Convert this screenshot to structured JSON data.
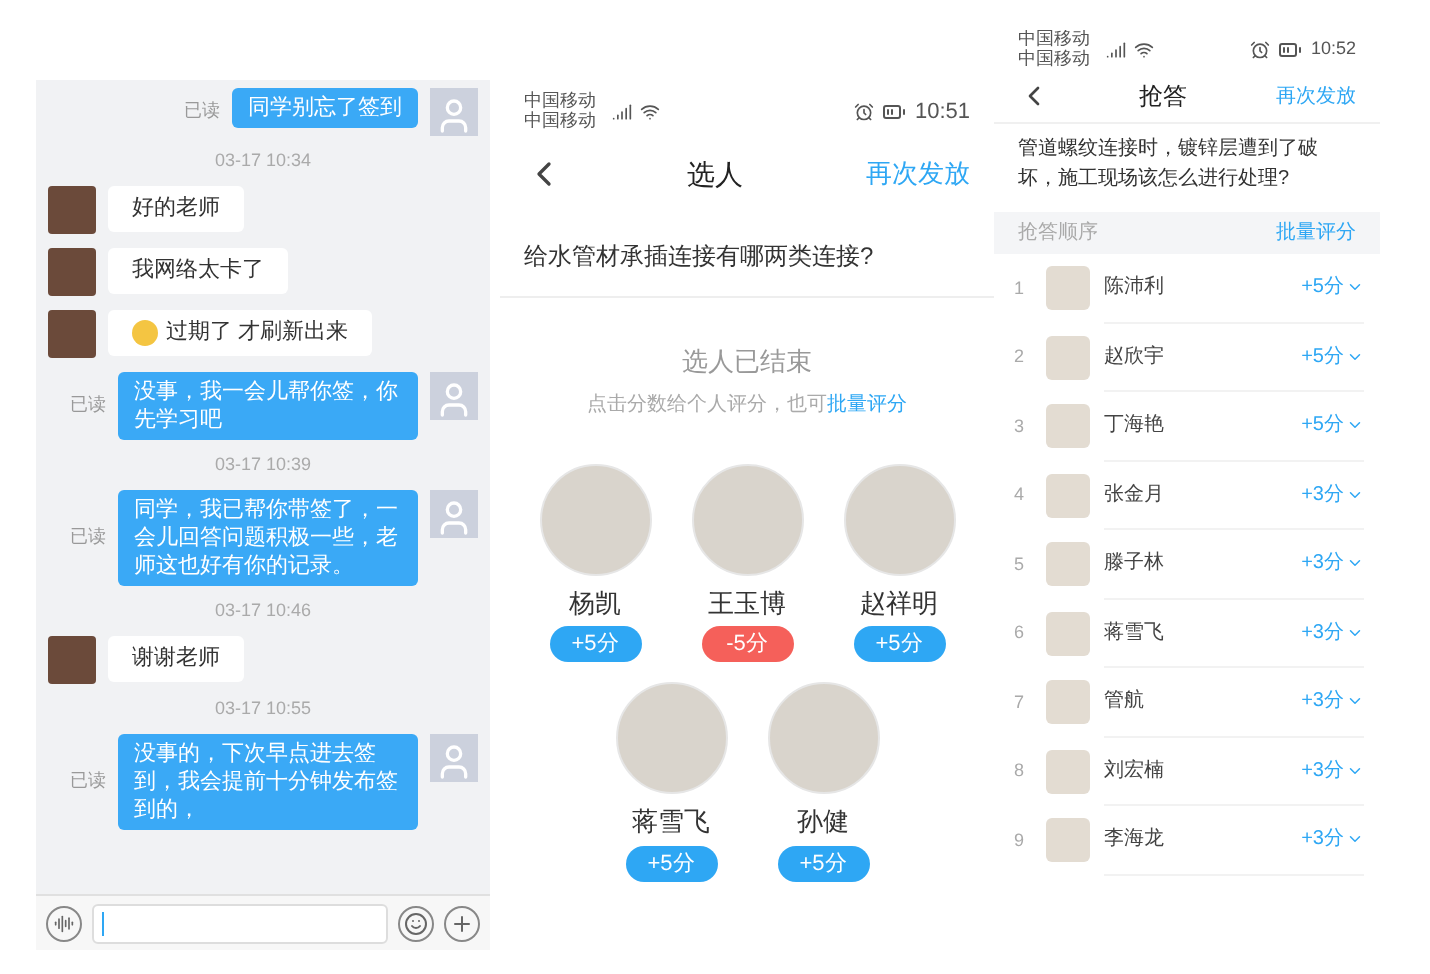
{
  "chat": {
    "messages": [
      {
        "kind": "out",
        "read": "已读",
        "text": "同学别忘了签到"
      },
      {
        "kind": "time",
        "text": "03-17 10:34"
      },
      {
        "kind": "in",
        "emoji": false,
        "text": "好的老师"
      },
      {
        "kind": "in",
        "emoji": false,
        "text": "我网络太卡了"
      },
      {
        "kind": "in",
        "emoji": true,
        "text": "过期了 才刷新出来"
      },
      {
        "kind": "out",
        "read": "已读",
        "text": "没事，我一会儿帮你签，你先学习吧"
      },
      {
        "kind": "time",
        "text": "03-17 10:39"
      },
      {
        "kind": "out",
        "read": "已读",
        "text": "同学，我已帮你带签了，一会儿回答问题积极一些，老师这也好有你的记录。"
      },
      {
        "kind": "time",
        "text": "03-17 10:46"
      },
      {
        "kind": "in",
        "emoji": false,
        "text": "谢谢老师"
      },
      {
        "kind": "time",
        "text": "03-17 10:55"
      },
      {
        "kind": "out",
        "read": "已读",
        "text": "没事的，下次早点进去签到，我会提前十分钟发布签到的，"
      }
    ]
  },
  "picker": {
    "status": {
      "carriers": [
        "中国移动",
        "中国移动"
      ],
      "time": "10:51"
    },
    "title": "选人",
    "action": "再次发放",
    "question": "给水管材承插连接有哪两类连接?",
    "ended": "选人已结束",
    "hint": "点击分数给个人评分，也可",
    "hint_link": "批量评分",
    "people": [
      {
        "name": "杨凯",
        "score": "+5分",
        "color": "#2ea7f4"
      },
      {
        "name": "王玉博",
        "score": "-5分",
        "color": "#f5605a"
      },
      {
        "name": "赵祥明",
        "score": "+5分",
        "color": "#2ea7f4"
      },
      {
        "name": "蒋雪飞",
        "score": "+5分",
        "color": "#2ea7f4"
      },
      {
        "name": "孙健",
        "score": "+5分",
        "color": "#2ea7f4"
      }
    ]
  },
  "race": {
    "status": {
      "carriers": [
        "中国移动",
        "中国移动"
      ],
      "time": "10:52"
    },
    "title": "抢答",
    "action": "再次发放",
    "question": "管道螺纹连接时，镀锌层遭到了破坏，施工现场该怎么进行处理?",
    "order_label": "抢答顺序",
    "batch": "批量评分",
    "rows": [
      {
        "rank": "1",
        "name": "陈沛利",
        "score": "+5分"
      },
      {
        "rank": "2",
        "name": "赵欣宇",
        "score": "+5分"
      },
      {
        "rank": "3",
        "name": "丁海艳",
        "score": "+5分"
      },
      {
        "rank": "4",
        "name": "张金月",
        "score": "+3分"
      },
      {
        "rank": "5",
        "name": "滕子林",
        "score": "+3分"
      },
      {
        "rank": "6",
        "name": "蒋雪飞",
        "score": "+3分"
      },
      {
        "rank": "7",
        "name": "管航",
        "score": "+3分"
      },
      {
        "rank": "8",
        "name": "刘宏楠",
        "score": "+3分"
      },
      {
        "rank": "9",
        "name": "李海龙",
        "score": "+3分"
      }
    ]
  }
}
